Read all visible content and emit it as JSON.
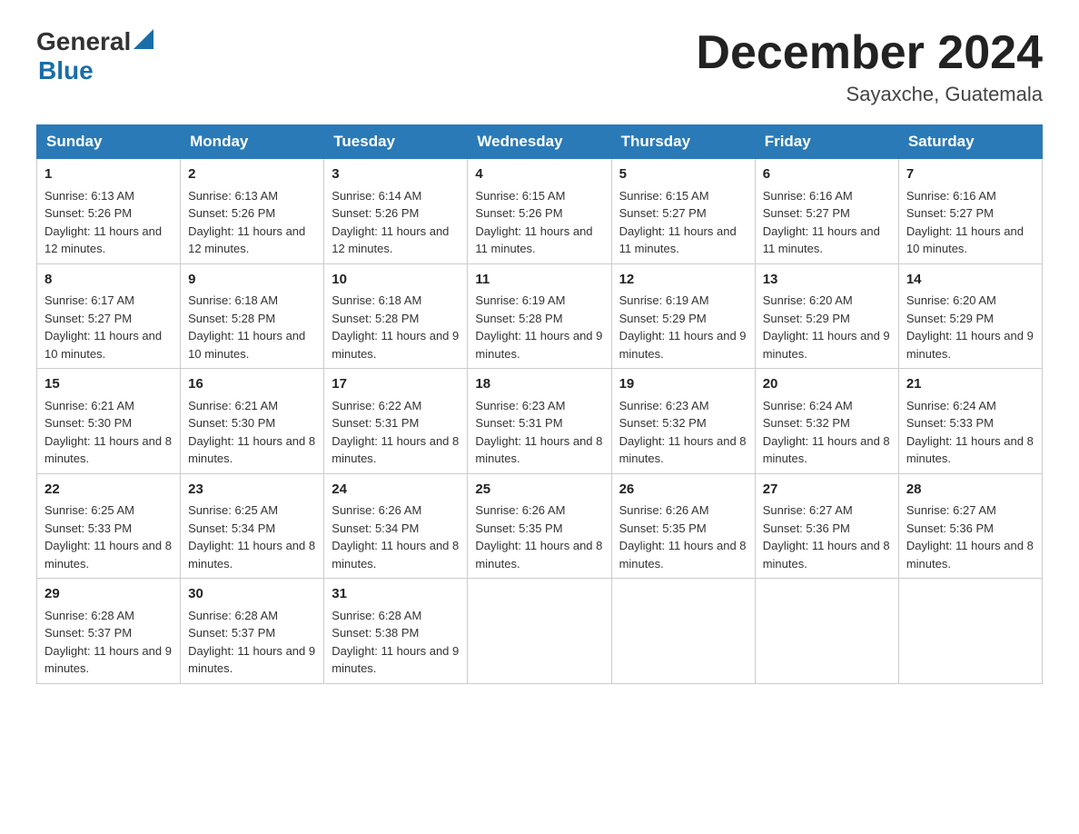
{
  "logo": {
    "general": "General",
    "blue": "Blue"
  },
  "header": {
    "month": "December 2024",
    "location": "Sayaxche, Guatemala"
  },
  "weekdays": [
    "Sunday",
    "Monday",
    "Tuesday",
    "Wednesday",
    "Thursday",
    "Friday",
    "Saturday"
  ],
  "weeks": [
    [
      {
        "day": "1",
        "sunrise": "6:13 AM",
        "sunset": "5:26 PM",
        "daylight": "11 hours and 12 minutes."
      },
      {
        "day": "2",
        "sunrise": "6:13 AM",
        "sunset": "5:26 PM",
        "daylight": "11 hours and 12 minutes."
      },
      {
        "day": "3",
        "sunrise": "6:14 AM",
        "sunset": "5:26 PM",
        "daylight": "11 hours and 12 minutes."
      },
      {
        "day": "4",
        "sunrise": "6:15 AM",
        "sunset": "5:26 PM",
        "daylight": "11 hours and 11 minutes."
      },
      {
        "day": "5",
        "sunrise": "6:15 AM",
        "sunset": "5:27 PM",
        "daylight": "11 hours and 11 minutes."
      },
      {
        "day": "6",
        "sunrise": "6:16 AM",
        "sunset": "5:27 PM",
        "daylight": "11 hours and 11 minutes."
      },
      {
        "day": "7",
        "sunrise": "6:16 AM",
        "sunset": "5:27 PM",
        "daylight": "11 hours and 10 minutes."
      }
    ],
    [
      {
        "day": "8",
        "sunrise": "6:17 AM",
        "sunset": "5:27 PM",
        "daylight": "11 hours and 10 minutes."
      },
      {
        "day": "9",
        "sunrise": "6:18 AM",
        "sunset": "5:28 PM",
        "daylight": "11 hours and 10 minutes."
      },
      {
        "day": "10",
        "sunrise": "6:18 AM",
        "sunset": "5:28 PM",
        "daylight": "11 hours and 9 minutes."
      },
      {
        "day": "11",
        "sunrise": "6:19 AM",
        "sunset": "5:28 PM",
        "daylight": "11 hours and 9 minutes."
      },
      {
        "day": "12",
        "sunrise": "6:19 AM",
        "sunset": "5:29 PM",
        "daylight": "11 hours and 9 minutes."
      },
      {
        "day": "13",
        "sunrise": "6:20 AM",
        "sunset": "5:29 PM",
        "daylight": "11 hours and 9 minutes."
      },
      {
        "day": "14",
        "sunrise": "6:20 AM",
        "sunset": "5:29 PM",
        "daylight": "11 hours and 9 minutes."
      }
    ],
    [
      {
        "day": "15",
        "sunrise": "6:21 AM",
        "sunset": "5:30 PM",
        "daylight": "11 hours and 8 minutes."
      },
      {
        "day": "16",
        "sunrise": "6:21 AM",
        "sunset": "5:30 PM",
        "daylight": "11 hours and 8 minutes."
      },
      {
        "day": "17",
        "sunrise": "6:22 AM",
        "sunset": "5:31 PM",
        "daylight": "11 hours and 8 minutes."
      },
      {
        "day": "18",
        "sunrise": "6:23 AM",
        "sunset": "5:31 PM",
        "daylight": "11 hours and 8 minutes."
      },
      {
        "day": "19",
        "sunrise": "6:23 AM",
        "sunset": "5:32 PM",
        "daylight": "11 hours and 8 minutes."
      },
      {
        "day": "20",
        "sunrise": "6:24 AM",
        "sunset": "5:32 PM",
        "daylight": "11 hours and 8 minutes."
      },
      {
        "day": "21",
        "sunrise": "6:24 AM",
        "sunset": "5:33 PM",
        "daylight": "11 hours and 8 minutes."
      }
    ],
    [
      {
        "day": "22",
        "sunrise": "6:25 AM",
        "sunset": "5:33 PM",
        "daylight": "11 hours and 8 minutes."
      },
      {
        "day": "23",
        "sunrise": "6:25 AM",
        "sunset": "5:34 PM",
        "daylight": "11 hours and 8 minutes."
      },
      {
        "day": "24",
        "sunrise": "6:26 AM",
        "sunset": "5:34 PM",
        "daylight": "11 hours and 8 minutes."
      },
      {
        "day": "25",
        "sunrise": "6:26 AM",
        "sunset": "5:35 PM",
        "daylight": "11 hours and 8 minutes."
      },
      {
        "day": "26",
        "sunrise": "6:26 AM",
        "sunset": "5:35 PM",
        "daylight": "11 hours and 8 minutes."
      },
      {
        "day": "27",
        "sunrise": "6:27 AM",
        "sunset": "5:36 PM",
        "daylight": "11 hours and 8 minutes."
      },
      {
        "day": "28",
        "sunrise": "6:27 AM",
        "sunset": "5:36 PM",
        "daylight": "11 hours and 8 minutes."
      }
    ],
    [
      {
        "day": "29",
        "sunrise": "6:28 AM",
        "sunset": "5:37 PM",
        "daylight": "11 hours and 9 minutes."
      },
      {
        "day": "30",
        "sunrise": "6:28 AM",
        "sunset": "5:37 PM",
        "daylight": "11 hours and 9 minutes."
      },
      {
        "day": "31",
        "sunrise": "6:28 AM",
        "sunset": "5:38 PM",
        "daylight": "11 hours and 9 minutes."
      },
      null,
      null,
      null,
      null
    ]
  ],
  "labels": {
    "sunrise": "Sunrise:",
    "sunset": "Sunset:",
    "daylight": "Daylight:"
  }
}
